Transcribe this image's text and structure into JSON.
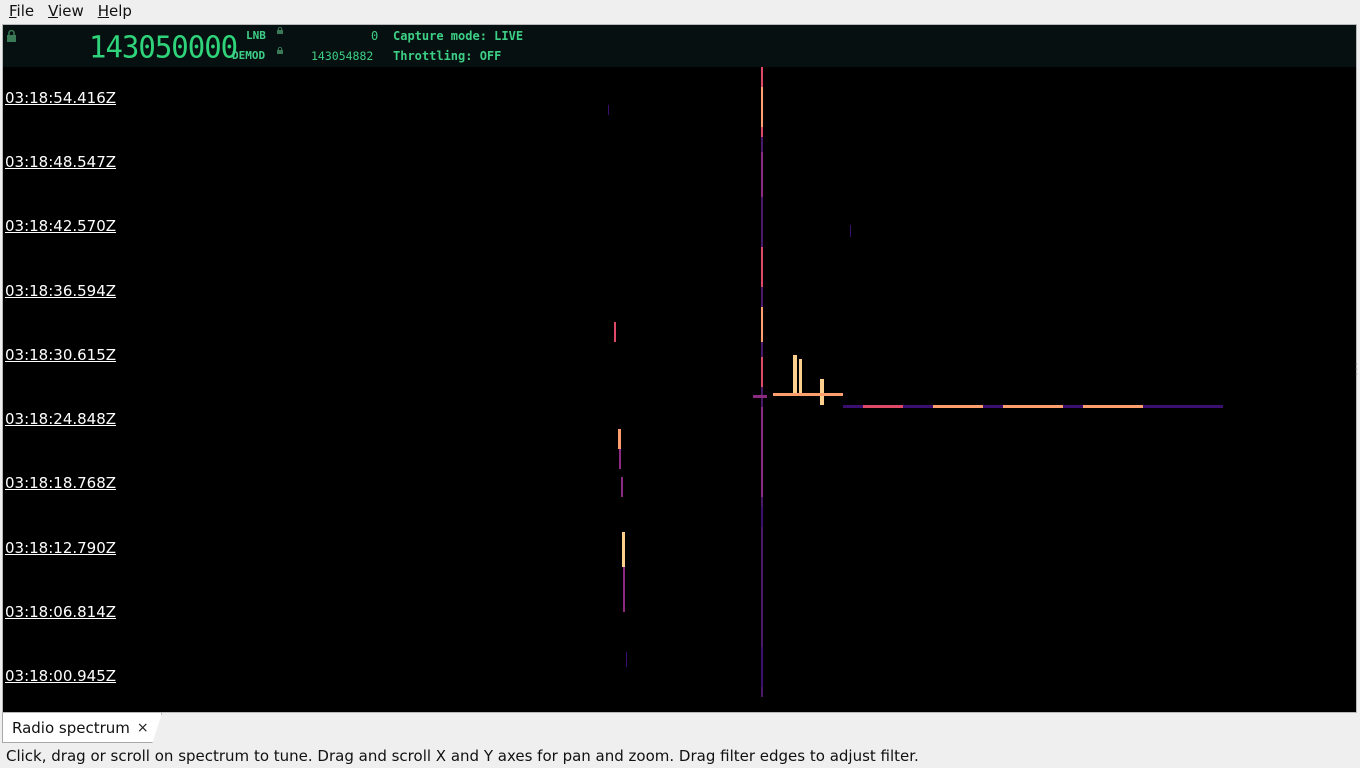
{
  "menubar": {
    "items": [
      {
        "mnemonic": "F",
        "rest": "ile"
      },
      {
        "mnemonic": "V",
        "rest": "iew"
      },
      {
        "mnemonic": "H",
        "rest": "elp"
      }
    ]
  },
  "infobar": {
    "main_frequency": "143050000",
    "lnb_label": "LNB",
    "lnb_value": "0",
    "demod_label": "DEMOD",
    "demod_value": "143054882",
    "capture_mode": "Capture mode: LIVE",
    "throttling": "Throttling: OFF",
    "text_color": "#3ecf86"
  },
  "waterfall": {
    "timestamps": [
      "03:18:54.416Z",
      "03:18:48.547Z",
      "03:18:42.570Z",
      "03:18:36.594Z",
      "03:18:30.615Z",
      "03:18:24.848Z",
      "03:18:18.768Z",
      "03:18:12.790Z",
      "03:18:06.814Z",
      "03:18:00.945Z"
    ],
    "colormap": [
      "#000000",
      "#3b0f70",
      "#8c2981",
      "#de4968",
      "#fe9f6d",
      "#fcfdbf"
    ]
  },
  "tabs": [
    {
      "label": "Radio spectrum",
      "close_glyph": "×"
    }
  ],
  "status_hint": "Click, drag or scroll on spectrum to tune. Drag and scroll X and Y axes for pan and zoom. Drag filter edges to adjust filter."
}
